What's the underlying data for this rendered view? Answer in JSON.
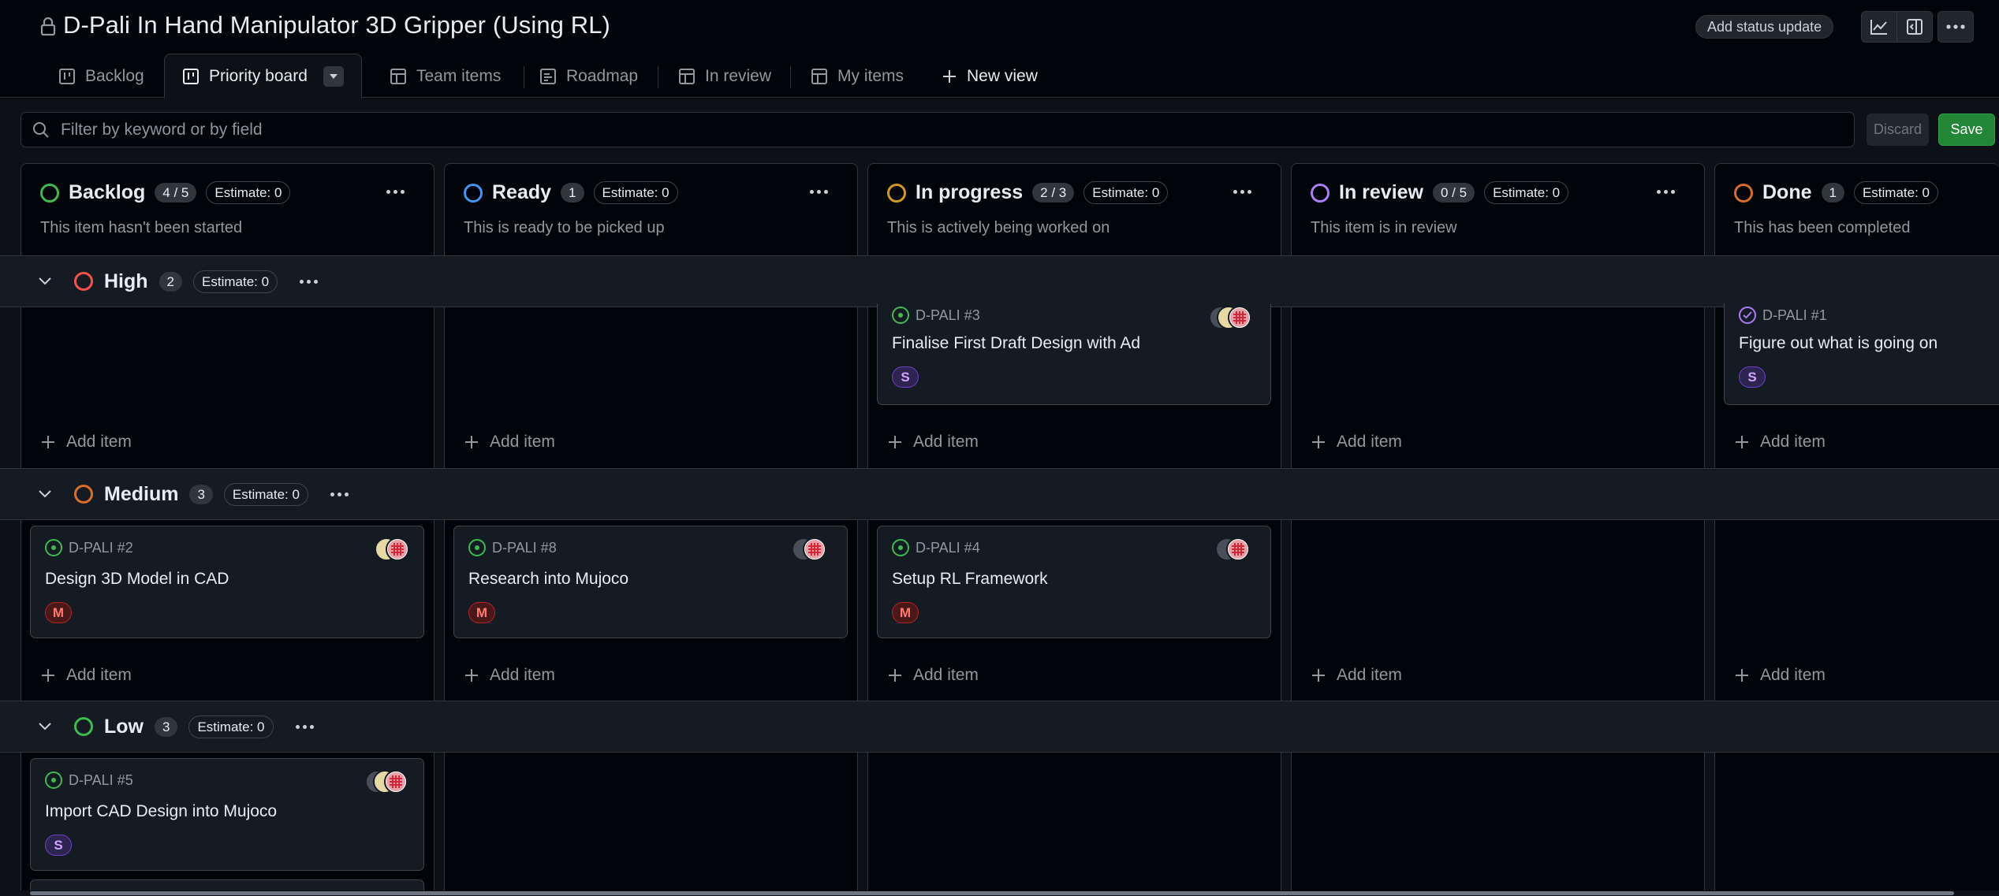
{
  "header": {
    "title": "D-Pali In Hand Manipulator 3D Gripper (Using RL)",
    "status_button": "Add status update"
  },
  "tabs": [
    {
      "label": "Backlog",
      "icon": "board-icon"
    },
    {
      "label": "Priority board",
      "icon": "board-icon",
      "active": true
    },
    {
      "label": "Team items",
      "icon": "table-icon"
    },
    {
      "label": "Roadmap",
      "icon": "roadmap-icon"
    },
    {
      "label": "In review",
      "icon": "table-icon"
    },
    {
      "label": "My items",
      "icon": "table-icon"
    },
    {
      "label": "New view",
      "icon": "plus-icon"
    }
  ],
  "filter": {
    "placeholder": "Filter by keyword or by field",
    "discard": "Discard",
    "save": "Save"
  },
  "columns": [
    {
      "name": "Backlog",
      "count": "4 / 5",
      "estimate": "Estimate: 0",
      "description": "This item hasn't been started",
      "color": "#3fb950"
    },
    {
      "name": "Ready",
      "count": "1",
      "estimate": "Estimate: 0",
      "description": "This is ready to be picked up",
      "color": "#4493f8"
    },
    {
      "name": "In progress",
      "count": "2 / 3",
      "estimate": "Estimate: 0",
      "description": "This is actively being worked on",
      "color": "#d29922"
    },
    {
      "name": "In review",
      "count": "0 / 5",
      "estimate": "Estimate: 0",
      "description": "This item is in review",
      "color": "#ab7df8"
    },
    {
      "name": "Done",
      "count": "1",
      "estimate": "Estimate: 0",
      "description": "This has been completed",
      "color": "#db6d28"
    }
  ],
  "groups": [
    {
      "name": "High",
      "count": "2",
      "estimate": "Estimate: 0",
      "color": "#f85149"
    },
    {
      "name": "Medium",
      "count": "3",
      "estimate": "Estimate: 0",
      "color": "#db6d28"
    },
    {
      "name": "Low",
      "count": "3",
      "estimate": "Estimate: 0",
      "color": "#3fb950"
    }
  ],
  "add_item_label": "Add item",
  "cards": {
    "high_in_progress": {
      "id": "D-PALI #3",
      "title": "Finalise First Draft Design with Ad",
      "size": "S"
    },
    "high_done": {
      "id": "D-PALI #1",
      "title": "Figure out what is going on",
      "size": "S"
    },
    "medium_backlog": {
      "id": "D-PALI #2",
      "title": "Design 3D Model in CAD",
      "size": "M"
    },
    "medium_ready": {
      "id": "D-PALI #8",
      "title": "Research into Mujoco",
      "size": "M"
    },
    "medium_in_progress": {
      "id": "D-PALI #4",
      "title": "Setup RL Framework",
      "size": "M"
    },
    "low_backlog": {
      "id": "D-PALI #5",
      "title": "Import CAD Design into Mujoco",
      "size": "S"
    }
  }
}
